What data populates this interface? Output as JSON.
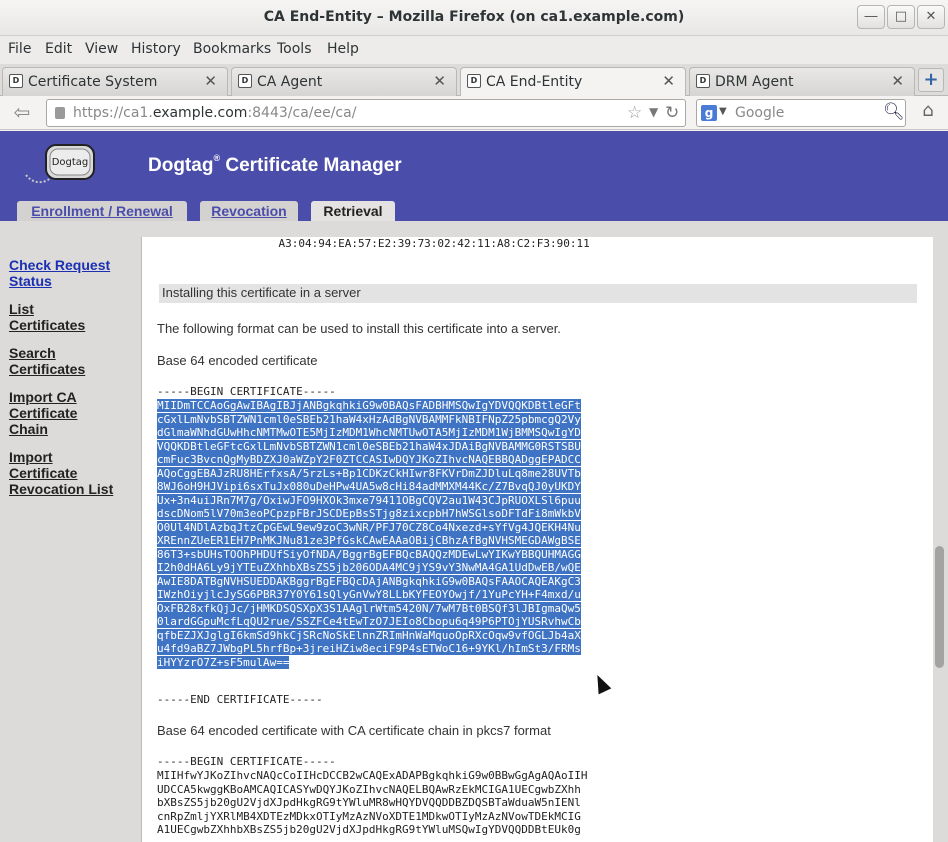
{
  "window": {
    "title": "CA End-Entity – Mozilla Firefox (on ca1.example.com)",
    "controls": [
      "―",
      "□",
      "✕"
    ]
  },
  "menu": [
    "File",
    "Edit",
    "View",
    "History",
    "Bookmarks",
    "Tools",
    "Help"
  ],
  "tabs": [
    {
      "label": "Certificate System",
      "active": false
    },
    {
      "label": "CA Agent",
      "active": false
    },
    {
      "label": "CA End-Entity",
      "active": true
    },
    {
      "label": "DRM Agent",
      "active": false
    }
  ],
  "nav": {
    "url_prefix": "https://ca1.",
    "url_host": "example.com",
    "url_suffix": ":8443/ca/ee/ca/",
    "search_placeholder": "Google"
  },
  "banner": {
    "logo_text": "Dogtag",
    "title": "Dogtag",
    "title_sup": "®",
    "title_rest": " Certificate Manager",
    "tabs": [
      {
        "label": "Enrollment / Renewal",
        "active": false
      },
      {
        "label": "Revocation",
        "active": false
      },
      {
        "label": "Retrieval",
        "active": true
      }
    ]
  },
  "sidebar": [
    {
      "lines": [
        "Check Request",
        "Status"
      ],
      "visited": false
    },
    {
      "lines": [
        "List",
        "Certificates"
      ],
      "visited": true
    },
    {
      "lines": [
        "Search",
        "Certificates"
      ],
      "visited": true
    },
    {
      "lines": [
        "Import CA",
        "Certificate",
        "Chain"
      ],
      "visited": true
    },
    {
      "lines": [
        "Import",
        "Certificate",
        "Revocation List"
      ],
      "visited": true
    }
  ],
  "main": {
    "fingerprint_line": "    A3:04:94:EA:57:E2:39:73:02:42:11:A8:C2:F3:90:11",
    "section_title": "Installing this certificate in a server",
    "intro": "The following format can be used to install this certificate into a server.",
    "base64_label": "Base 64 encoded certificate",
    "begin": "-----BEGIN CERTIFICATE-----",
    "end": "-----END CERTIFICATE-----",
    "cert_lines": [
      "MIIDmTCCAoGgAwIBAgIBJjANBgkqhkiG9w0BAQsFADBHMSQwIgYDVQQKDBtleGFt",
      "cGxlLmNvbSBTZWN1cml0eSBEb21haW4xHzAdBgNVBAMMFkNBIFNpZ25pbmcgQ2Vy",
      "dGlmaWNhdGUwHhcNMTMwOTE5MjIzMDM1WhcNMTUwOTA5MjIzMDM1WjBMMSQwIgYD",
      "VQQKDBtleGFtcGxlLmNvbSBTZWN1cml0eSBEb21haW4xJDAiBgNVBAMMG0RSTSBU",
      "cmFuc3BvcnQgMyBDZXJ0aWZpY2F0ZTCCASIwDQYJKoZIhvcNAQEBBQADggEPADCC",
      "AQoCggEBAJzRU8HErfxsA/5rzLs+Bp1CDKzCkHIwr8FKVrDmZJDluLq8me28UVTb",
      "8WJ6oH9HJVipi6sxTuJx080uDeHPw4UA5w8cHi84adMMXM44Kc/Z7BvqQJ0yUKDY",
      "Ux+3n4uiJRn7M7g/OxiwJFO9HXOk3mxe79411OBgCQV2au1W43CJpRUOXLSl6puu",
      "dscDNom5lV70m3eoPCpzpFBrJSCDEpBsSTjg8zixcpbH7hWSGlsoDFTdFi8mWkbV",
      "O0Ul4NDlAzbqJtzCpGEwL9ew9zoC3wNR/PFJ70CZ8Co4Nxezd+sYfVg4JQEKH4Nu",
      "XREnnZUeER1EH7PnMKJNu81ze3PfGskCAwEAAaOBijCBhzAfBgNVHSMEGDAWgBSE",
      "86T3+sbUHsTOOhPHDUfSiyOfNDA/BggrBgEFBQcBAQQzMDEwLwYIKwYBBQUHMAGG",
      "I2h0dHA6Ly9jYTEuZXhhbXBsZS5jb206ODA4MC9jYS9vY3NwMA4GA1UdDwEB/wQE",
      "AwIE8DATBgNVHSUEDDAKBggrBgEFBQcDAjANBgkqhkiG9w0BAQsFAAOCAQEAKgC3",
      "IWzhOiyjlcJySG6PBR37Y0Y61sQlyGnVwY8LLbKYFEOYOwjf/1YuPcYH+F4mxd/u",
      "OxFB28xfkQjJc/jHMKDSQSXpX3S1AAglrWtm5420N/7wM7Bt0BSQf3lJBIgmaQw5",
      "0lardGGpuMcfLqQU2rue/SSZFCe4tEwTzO7JEIo8Cbopu6q49P6PTOjYUSRvhwCb",
      "qfbEZJXJglgI6kmSd9hkCjSRcNoSkElnnZRImHnWaMquoOpRXcOqw9vfOGLJb4aX",
      "u4fd9aBZ7JWbgPL5hrfBp+3jreiHZiw8eciF9P4sETWoC16+9YKl/hImSt3/FRMs",
      "iHYYzrO7Z+sF5mulAw=="
    ],
    "pkcs7_label": "Base 64 encoded certificate with CA certificate chain in pkcs7 format",
    "pkcs7_lines": [
      "MIIHfwYJKoZIhvcNAQcCoIIHcDCCB2wCAQExADAPBgkqhkiG9w0BBwGgAgAQAoIIH",
      "UDCCA5kwggKBoAMCAQICASYwDQYJKoZIhvcNAQELBQAwRzEkMCIGA1UECgwbZXhh",
      "bXBsZS5jb20gU2VjdXJpdHkgRG9tYWluMR8wHQYDVQQDDBZDQSBTaWduaW5nIENl",
      "cnRpZmljYXRlMB4XDTEzMDkxOTIyMzAzNVoXDTE1MDkwOTIyMzAzNVowTDEkMCIG",
      "A1UECgwbZXhhbXBsZS5jb20gU2VjdXJpdHkgRG9tYWluMSQwIgYDVQQDDBtEUk0g"
    ]
  }
}
